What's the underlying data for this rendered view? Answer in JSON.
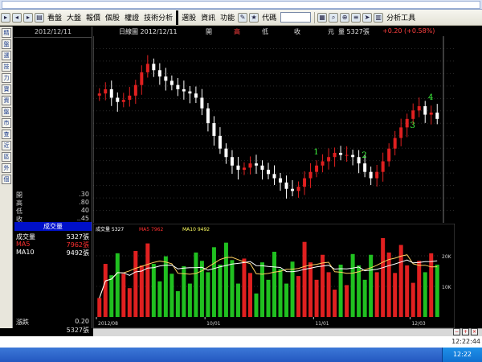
{
  "toolbar": {
    "items": [
      "看盤",
      "大盤",
      "報價",
      "個股",
      "權證",
      "技術分析",
      "選股",
      "資訊",
      "功能",
      "代碼",
      "分析工具"
    ]
  },
  "left_nav": [
    "精",
    "盤",
    "選",
    "技",
    "力",
    "寶",
    "資",
    "盤",
    "市",
    "查",
    "近",
    "區",
    "外",
    "個"
  ],
  "info": {
    "date": "2012/12/11",
    "quote": [
      {
        "label": "開",
        "value": ".30"
      },
      {
        "label": "高",
        "value": ".80"
      },
      {
        "label": "低",
        "value": "40"
      },
      {
        "label": "收",
        "value": "..45"
      }
    ],
    "volume_title": "成交量",
    "volume": [
      {
        "label": "成交量",
        "value": "5327張",
        "color": "#ffffff"
      },
      {
        "label": "MA5",
        "value": "7962張",
        "color": "#ff3030"
      },
      {
        "label": "MA10",
        "value": "9492張",
        "color": "#ffffff"
      }
    ],
    "footer": [
      {
        "label": "漲跌",
        "value": "0.20"
      },
      {
        "label": "",
        "value": "5327張"
      }
    ]
  },
  "chart_header": {
    "title": "日線圖 2012/12/11",
    "open_label": "開",
    "high_label": "高",
    "low_label": "低",
    "close_label": "收",
    "unit": "元",
    "volume_text": "量 5327張",
    "change_text": "+0.20 (+0.58%)"
  },
  "chart_data": {
    "type": "candlestick",
    "date_range": [
      "2012/08",
      "2012/12/11"
    ],
    "x_ticks": [
      "2012/08",
      "10/01",
      "11/01",
      "12/03"
    ],
    "candles_approx_close": [
      34.2,
      34.4,
      34.0,
      33.8,
      33.9,
      34.1,
      34.6,
      35.2,
      35.6,
      35.3,
      35.0,
      34.8,
      34.6,
      34.4,
      34.3,
      34.2,
      34.0,
      33.5,
      32.8,
      32.2,
      31.6,
      31.2,
      30.8,
      30.6,
      30.7,
      30.9,
      30.8,
      30.6,
      30.4,
      30.2,
      30.0,
      29.7,
      29.6,
      29.8,
      30.2,
      30.5,
      30.8,
      31.0,
      31.2,
      31.4,
      31.3,
      31.3,
      31.2,
      30.9,
      30.5,
      30.2,
      30.5,
      31.0,
      31.6,
      32.1,
      32.6,
      33.0,
      33.4,
      33.6,
      33.2,
      33.3,
      33.0
    ],
    "annotations": [
      "1",
      "2",
      "3",
      "4"
    ],
    "volume": {
      "labels": [
        "成交量 5327",
        "MA5 7962",
        "MA10 9492"
      ],
      "y_ticks": [
        "20K",
        "10K"
      ]
    }
  },
  "status": {
    "tray_time": "12:22",
    "clock": "12:22:44"
  }
}
